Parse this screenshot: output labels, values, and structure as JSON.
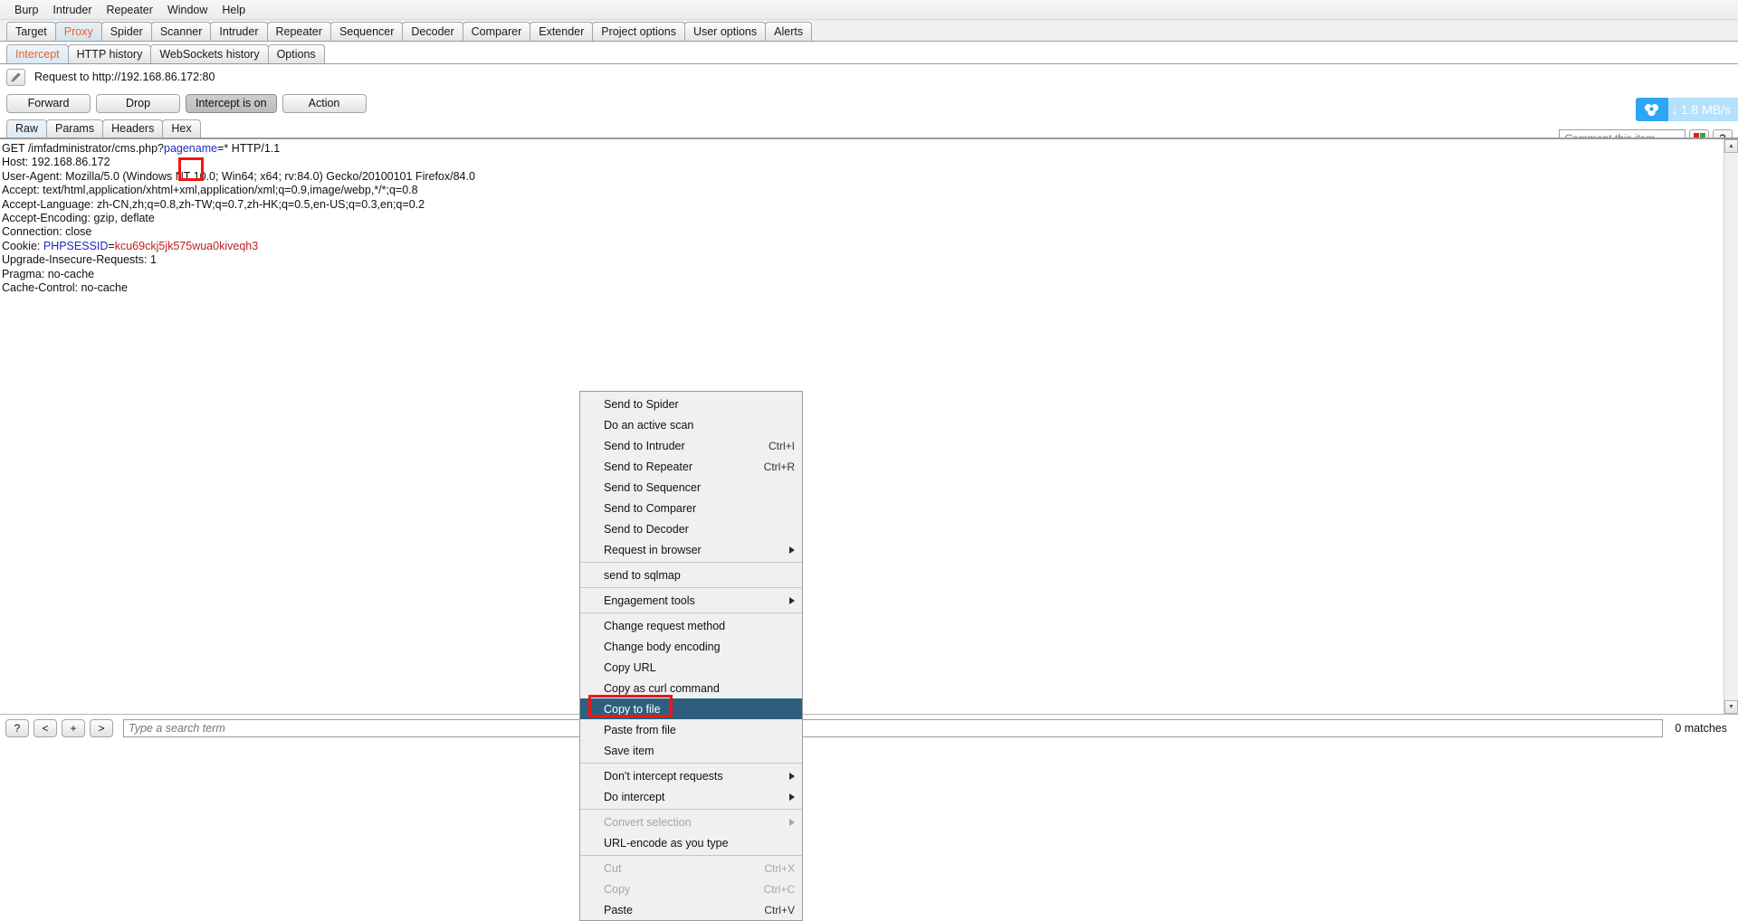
{
  "menubar": {
    "items": [
      {
        "label": "Burp"
      },
      {
        "label": "Intruder"
      },
      {
        "label": "Repeater"
      },
      {
        "label": "Window"
      },
      {
        "label": "Help"
      }
    ]
  },
  "main_tabs": {
    "active": "Proxy",
    "items": [
      {
        "label": "Target"
      },
      {
        "label": "Proxy"
      },
      {
        "label": "Spider"
      },
      {
        "label": "Scanner"
      },
      {
        "label": "Intruder"
      },
      {
        "label": "Repeater"
      },
      {
        "label": "Sequencer"
      },
      {
        "label": "Decoder"
      },
      {
        "label": "Comparer"
      },
      {
        "label": "Extender"
      },
      {
        "label": "Project options"
      },
      {
        "label": "User options"
      },
      {
        "label": "Alerts"
      }
    ]
  },
  "sub_tabs": {
    "active": "Intercept",
    "items": [
      {
        "label": "Intercept"
      },
      {
        "label": "HTTP history"
      },
      {
        "label": "WebSockets history"
      },
      {
        "label": "Options"
      }
    ]
  },
  "request_header": {
    "title": "Request to http://192.168.86.172:80",
    "edit_icon": "pencil-icon"
  },
  "buttons": {
    "forward": "Forward",
    "drop": "Drop",
    "intercept": "Intercept is on",
    "action": "Action"
  },
  "editor_tabs": {
    "active": "Raw",
    "items": [
      {
        "label": "Raw"
      },
      {
        "label": "Params"
      },
      {
        "label": "Headers"
      },
      {
        "label": "Hex"
      }
    ]
  },
  "request": {
    "line1_pre": "GET /imfadministrator/cms.php?",
    "line1_param": "pagename",
    "line1_post": "=* HTTP/1.1",
    "lines": [
      "Host: 192.168.86.172",
      "User-Agent: Mozilla/5.0 (Windows NT 10.0; Win64; x64; rv:84.0) Gecko/20100101 Firefox/84.0",
      "Accept: text/html,application/xhtml+xml,application/xml;q=0.9,image/webp,*/*;q=0.8",
      "Accept-Language: zh-CN,zh;q=0.8,zh-TW;q=0.7,zh-HK;q=0.5,en-US;q=0.3,en;q=0.2",
      "Accept-Encoding: gzip, deflate",
      "Connection: close"
    ],
    "cookie_label": "Cookie: ",
    "cookie_name": "PHPSESSID",
    "cookie_eq": "=",
    "cookie_value": "kcu69ckj5jk575wua0kiveqh3",
    "lines_after": [
      "Upgrade-Insecure-Requests: 1",
      "Pragma: no-cache",
      "Cache-Control: no-cache"
    ]
  },
  "context_menu": {
    "selected": "Copy to file",
    "items": [
      {
        "label": "Send to Spider",
        "shortcut": "",
        "submenu": false,
        "disabled": false,
        "sep_before": false
      },
      {
        "label": "Do an active scan",
        "shortcut": "",
        "submenu": false,
        "disabled": false,
        "sep_before": false
      },
      {
        "label": "Send to Intruder",
        "shortcut": "Ctrl+I",
        "submenu": false,
        "disabled": false,
        "sep_before": false
      },
      {
        "label": "Send to Repeater",
        "shortcut": "Ctrl+R",
        "submenu": false,
        "disabled": false,
        "sep_before": false
      },
      {
        "label": "Send to Sequencer",
        "shortcut": "",
        "submenu": false,
        "disabled": false,
        "sep_before": false
      },
      {
        "label": "Send to Comparer",
        "shortcut": "",
        "submenu": false,
        "disabled": false,
        "sep_before": false
      },
      {
        "label": "Send to Decoder",
        "shortcut": "",
        "submenu": false,
        "disabled": false,
        "sep_before": false
      },
      {
        "label": "Request in browser",
        "shortcut": "",
        "submenu": true,
        "disabled": false,
        "sep_before": false
      },
      {
        "label": "send to sqlmap",
        "shortcut": "",
        "submenu": false,
        "disabled": false,
        "sep_before": true
      },
      {
        "label": "Engagement tools",
        "shortcut": "",
        "submenu": true,
        "disabled": false,
        "sep_before": true
      },
      {
        "label": "Change request method",
        "shortcut": "",
        "submenu": false,
        "disabled": false,
        "sep_before": true
      },
      {
        "label": "Change body encoding",
        "shortcut": "",
        "submenu": false,
        "disabled": false,
        "sep_before": false
      },
      {
        "label": "Copy URL",
        "shortcut": "",
        "submenu": false,
        "disabled": false,
        "sep_before": false
      },
      {
        "label": "Copy as curl command",
        "shortcut": "",
        "submenu": false,
        "disabled": false,
        "sep_before": false
      },
      {
        "label": "Copy to file",
        "shortcut": "",
        "submenu": false,
        "disabled": false,
        "sep_before": false
      },
      {
        "label": "Paste from file",
        "shortcut": "",
        "submenu": false,
        "disabled": false,
        "sep_before": false
      },
      {
        "label": "Save item",
        "shortcut": "",
        "submenu": false,
        "disabled": false,
        "sep_before": false
      },
      {
        "label": "Don't intercept requests",
        "shortcut": "",
        "submenu": true,
        "disabled": false,
        "sep_before": true
      },
      {
        "label": "Do intercept",
        "shortcut": "",
        "submenu": true,
        "disabled": false,
        "sep_before": false
      },
      {
        "label": "Convert selection",
        "shortcut": "",
        "submenu": true,
        "disabled": true,
        "sep_before": true
      },
      {
        "label": "URL-encode as you type",
        "shortcut": "",
        "submenu": false,
        "disabled": false,
        "sep_before": false
      },
      {
        "label": "Cut",
        "shortcut": "Ctrl+X",
        "submenu": false,
        "disabled": true,
        "sep_before": true
      },
      {
        "label": "Copy",
        "shortcut": "Ctrl+C",
        "submenu": false,
        "disabled": true,
        "sep_before": false
      },
      {
        "label": "Paste",
        "shortcut": "Ctrl+V",
        "submenu": false,
        "disabled": false,
        "sep_before": false
      }
    ]
  },
  "comment": {
    "placeholder": "Comment this item",
    "help_label": "?",
    "palette_icon": "color-palette-icon"
  },
  "netdisk": {
    "speed": "1.8 MB/s",
    "logo_icon": "cloud-disk-icon",
    "arrow_icon": "download-arrow-icon"
  },
  "bottom": {
    "help": "?",
    "prev": "<",
    "plus": "+",
    "next": ">",
    "search_placeholder": "Type a search term",
    "matches": "0 matches"
  },
  "colors": {
    "accent_orange": "#e8622a",
    "menu_select": "#2e5f7e",
    "annotation_red": "#f31414",
    "param_blue": "#1c29c4",
    "value_red": "#c02020",
    "netdisk_blue": "#2ca6f5"
  }
}
